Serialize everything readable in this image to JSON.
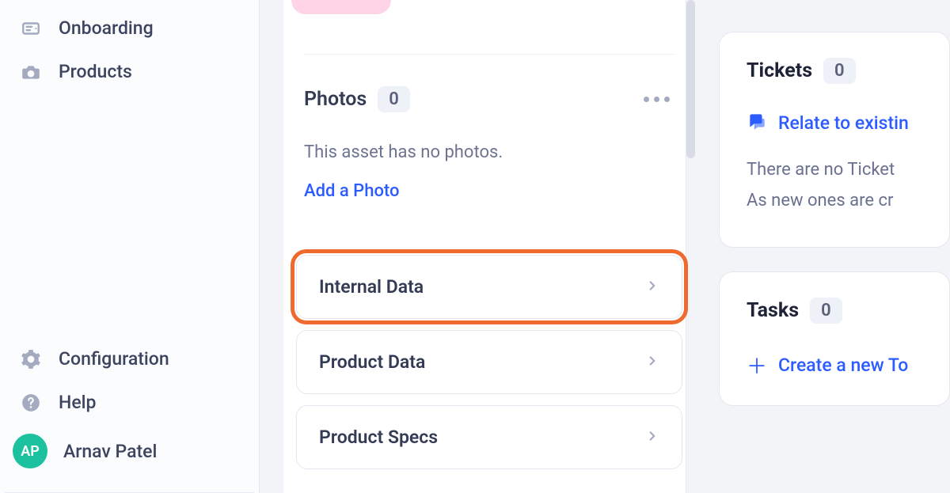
{
  "sidebar": {
    "top_items": [
      {
        "label": "Onboarding",
        "icon": "onboarding-icon"
      },
      {
        "label": "Products",
        "icon": "products-icon"
      }
    ],
    "bottom_items": [
      {
        "label": "Configuration",
        "icon": "gear-icon"
      },
      {
        "label": "Help",
        "icon": "help-icon"
      }
    ],
    "user": {
      "initials": "AP",
      "name": "Arnav Patel"
    }
  },
  "main": {
    "photos": {
      "title": "Photos",
      "count": "0",
      "empty_text": "This asset has no photos.",
      "add_label": "Add a Photo"
    },
    "accordion": [
      {
        "label": "Internal Data",
        "highlight": true
      },
      {
        "label": "Product Data",
        "highlight": false
      },
      {
        "label": "Product Specs",
        "highlight": false
      }
    ]
  },
  "right": {
    "tickets": {
      "title": "Tickets",
      "count": "0",
      "relate_label": "Relate to existin",
      "no_items": "There are no Ticket",
      "new_info": "As new ones are cr"
    },
    "tasks": {
      "title": "Tasks",
      "count": "0",
      "create_label": "Create a new To"
    }
  }
}
